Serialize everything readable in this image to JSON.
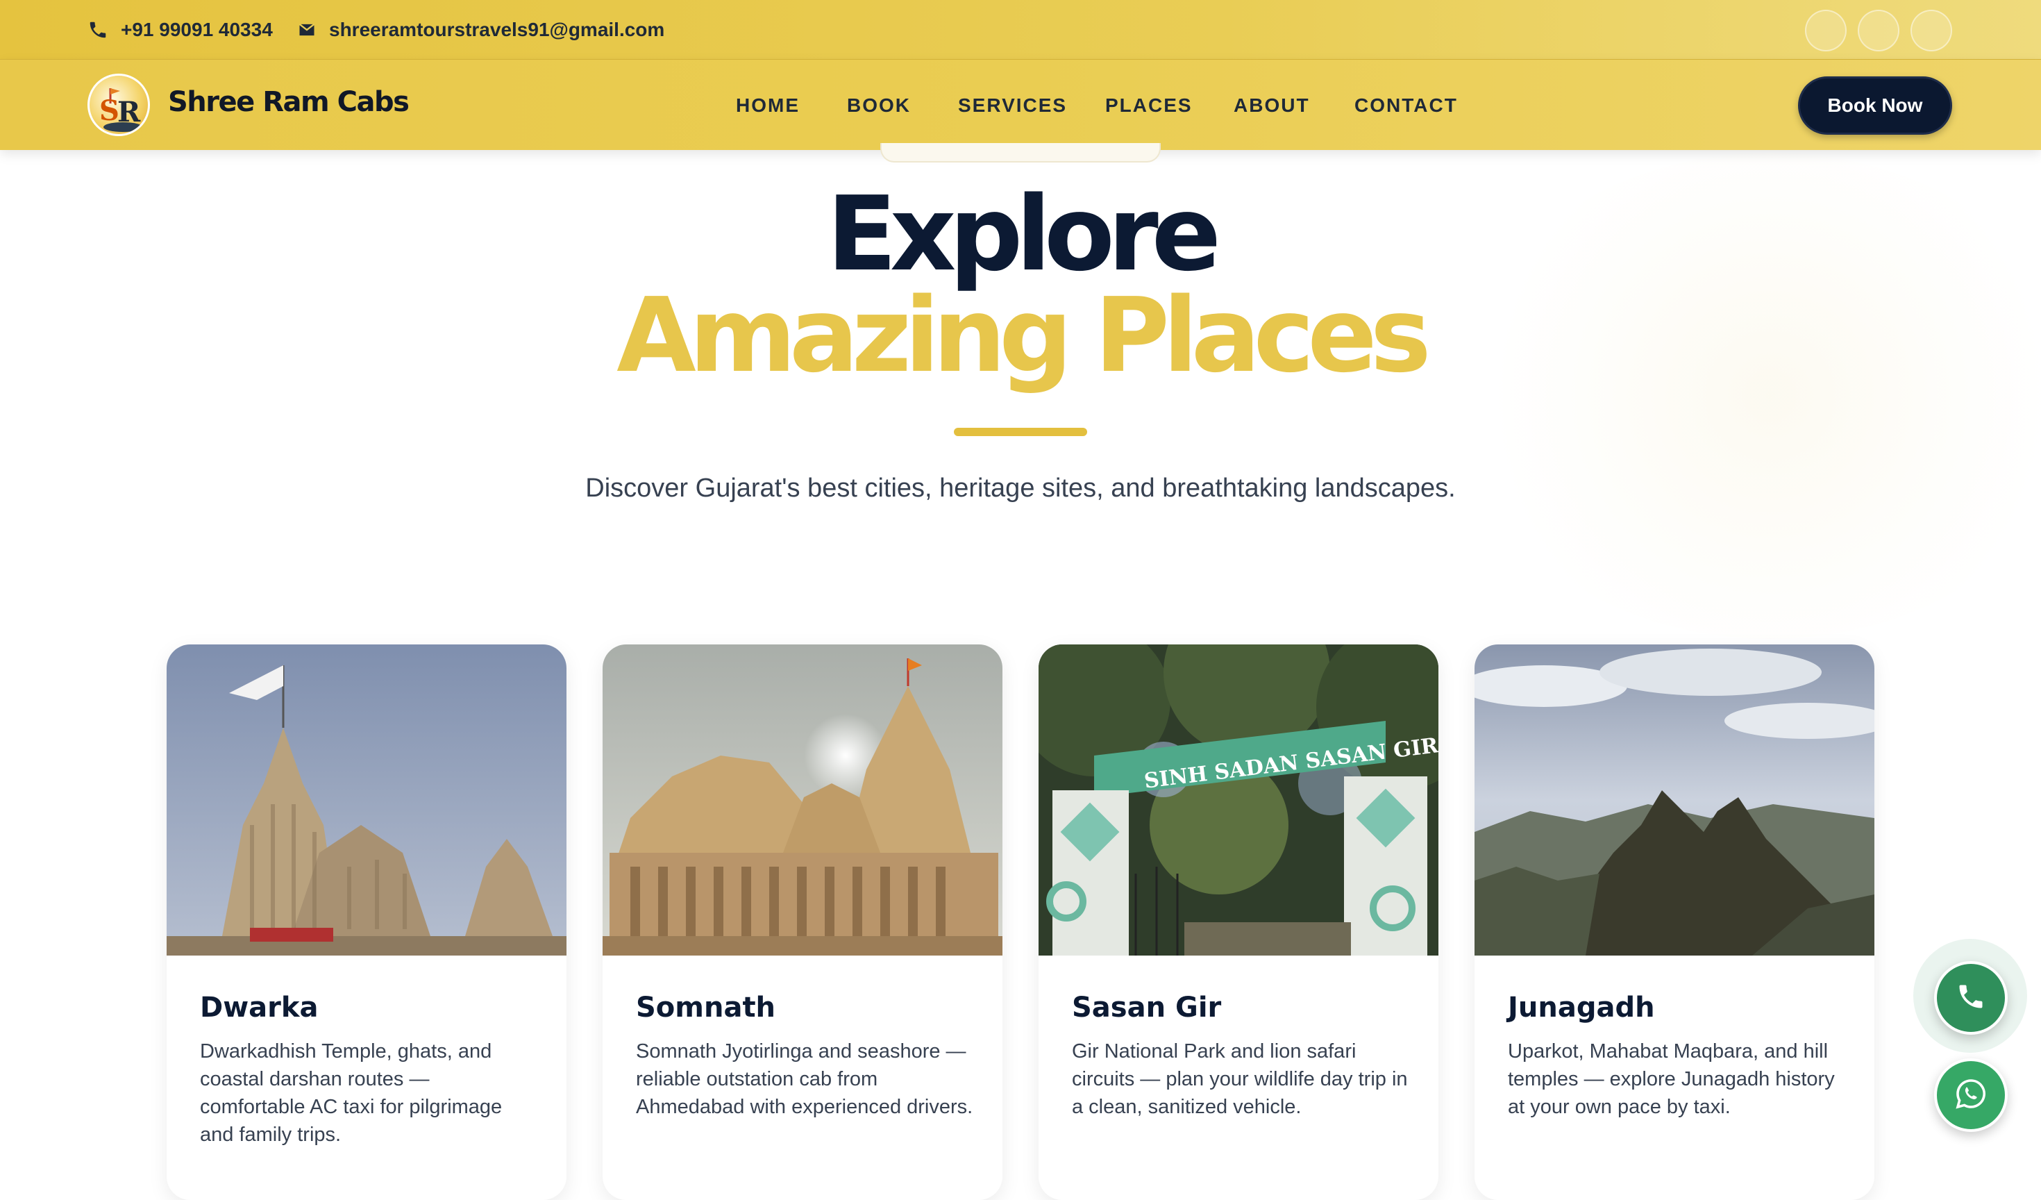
{
  "topbar": {
    "phone": "+91 99091 40334",
    "email": "shreeramtourstravels91@gmail.com",
    "social_icons": [
      "social-icon-1",
      "social-icon-2",
      "social-icon-3"
    ]
  },
  "navbar": {
    "brand": "Shree Ram Cabs",
    "menu": [
      "HOME",
      "BOOK",
      "SERVICES",
      "PLACES",
      "ABOUT",
      "CONTACT"
    ],
    "cta": "Book Now"
  },
  "hero": {
    "title_line1": "Explore",
    "title_line2": "Amazing Places",
    "subtitle": "Discover Gujarat's best cities, heritage sites, and breathtaking landscapes."
  },
  "places": [
    {
      "name": "Dwarka",
      "description": "Dwarkadhish Temple, ghats, and coastal darshan routes — comfortable AC taxi for pilgrimage and family trips.",
      "image": "dwarka-temple"
    },
    {
      "name": "Somnath",
      "description": "Somnath Jyotirlinga and seashore — reliable outstation cab from Ahmedabad with experienced drivers.",
      "image": "somnath-temple"
    },
    {
      "name": "Sasan Gir",
      "description": "Gir National Park and lion safari circuits — plan your wildlife day trip in a clean, sanitized vehicle.",
      "image": "sasan-gir-gate",
      "sign_text": "SINH SADAN SASAN GIR"
    },
    {
      "name": "Junagadh",
      "description": "Uparkot, Mahabat Maqbara, and hill temples — explore Junagadh history at your own pace by taxi.",
      "image": "junagadh-hills"
    }
  ],
  "floating": {
    "call_icon": "phone-icon",
    "whatsapp_icon": "whatsapp-icon"
  },
  "colors": {
    "gold": "#e7c64c",
    "navy": "#0c1a33",
    "green": "#2f8f5b"
  }
}
